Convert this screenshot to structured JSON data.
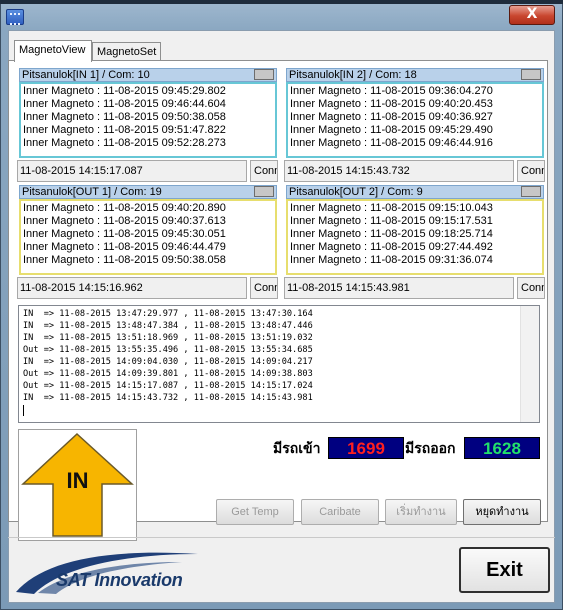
{
  "window": {
    "title_strip_text": "",
    "close_label": "X"
  },
  "tabs": [
    {
      "label": "MagnetoView",
      "active": true
    },
    {
      "label": "MagnetoSet",
      "active": false
    }
  ],
  "panels": {
    "in1": {
      "header": "Pitsanulok[IN 1] / Com: 10",
      "lines": [
        "Inner Magneto : 11-08-2015 09:45:29.802",
        "Inner Magneto : 11-08-2015 09:46:44.604",
        "Inner Magneto : 11-08-2015 09:50:38.058",
        "Inner Magneto : 11-08-2015 09:51:47.822",
        "Inner Magneto : 11-08-2015 09:52:28.273"
      ],
      "timestamp": "11-08-2015 14:15:17.087",
      "conn": "Conn"
    },
    "in2": {
      "header": "Pitsanulok[IN 2] / Com: 18",
      "lines": [
        "Inner Magneto : 11-08-2015 09:36:04.270",
        "Inner Magneto : 11-08-2015 09:40:20.453",
        "Inner Magneto : 11-08-2015 09:40:36.927",
        "Inner Magneto : 11-08-2015 09:45:29.490",
        "Inner Magneto : 11-08-2015 09:46:44.916"
      ],
      "timestamp": "11-08-2015 14:15:43.732",
      "conn": "Conn"
    },
    "out1": {
      "header": "Pitsanulok[OUT 1] / Com: 19",
      "lines": [
        "Inner Magneto : 11-08-2015 09:40:20.890",
        "Inner Magneto : 11-08-2015 09:40:37.613",
        "Inner Magneto : 11-08-2015 09:45:30.051",
        "Inner Magneto : 11-08-2015 09:46:44.479",
        "Inner Magneto : 11-08-2015 09:50:38.058"
      ],
      "timestamp": "11-08-2015 14:15:16.962",
      "conn": "Conn"
    },
    "out2": {
      "header": "Pitsanulok[OUT 2] / Com: 9",
      "lines": [
        "Inner Magneto : 11-08-2015 09:15:10.043",
        "Inner Magneto : 11-08-2015 09:15:17.531",
        "Inner Magneto : 11-08-2015 09:18:25.714",
        "Inner Magneto : 11-08-2015 09:27:44.492",
        "Inner Magneto : 11-08-2015 09:31:36.074"
      ],
      "timestamp": "11-08-2015 14:15:43.981",
      "conn": "Conn"
    }
  },
  "log": [
    "IN  => 11-08-2015 13:47:29.977 , 11-08-2015 13:47:30.164",
    "IN  => 11-08-2015 13:48:47.384 , 11-08-2015 13:48:47.446",
    "IN  => 11-08-2015 13:51:18.969 , 11-08-2015 13:51:19.032",
    "Out => 11-08-2015 13:55:35.496 , 11-08-2015 13:55:34.685",
    "IN  => 11-08-2015 14:09:04.030 , 11-08-2015 14:09:04.217",
    "Out => 11-08-2015 14:09:39.801 , 11-08-2015 14:09:38.803",
    "Out => 11-08-2015 14:15:17.087 , 11-08-2015 14:15:17.024",
    "IN  => 11-08-2015 14:15:43.732 , 11-08-2015 14:15:43.981"
  ],
  "direction": {
    "label": "IN",
    "arrow_color": "#f7b500",
    "icon": "up-arrow-icon"
  },
  "counters": {
    "in_label": "มีรถเข้า",
    "in_value": "1699",
    "in_color": "#ff1f1f",
    "out_label": "มีรถออก",
    "out_value": "1628",
    "out_color": "#22e06a"
  },
  "buttons": {
    "get_temp": "Get Temp",
    "caribate": "Caribate",
    "start": "เริ่มทำงาน",
    "stop": "หยุดทำงาน"
  },
  "footer": {
    "logo_text": "SAT Innovation",
    "exit_label": "Exit"
  }
}
